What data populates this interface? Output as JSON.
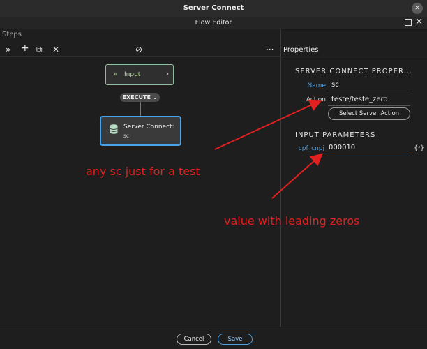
{
  "window": {
    "title": "Server Connect",
    "subtitle": "Flow Editor"
  },
  "left": {
    "label": "Steps",
    "toolbar": {
      "expand": "»",
      "add": "+",
      "copy": "⧉",
      "delete": "✕",
      "disable": "⊘",
      "more": "···"
    }
  },
  "flow": {
    "input_node": {
      "label": "Input",
      "icon": "»",
      "chevron": "›"
    },
    "execute_badge": "EXECUTE",
    "sc_node": {
      "label": "Server Connect:",
      "sub": "sc"
    }
  },
  "properties": {
    "title": "Properties",
    "section_main": "SERVER CONNECT PROPER...",
    "name_label": "Name",
    "name_value": "sc",
    "action_label": "Action",
    "action_value": "teste/teste_zero",
    "select_button": "Select Server Action",
    "section_params": "INPUT PARAMETERS",
    "param_label": "cpf_cnpj",
    "param_value": "000010",
    "fx": "{",
    "fx_end": "}"
  },
  "annotations": {
    "note1": "any sc just for a test",
    "note2": "value with leading zeros"
  },
  "footer": {
    "cancel": "Cancel",
    "save": "Save"
  },
  "colors": {
    "accent": "#4aa3e8",
    "annotation": "#e12020",
    "link_label": "#4aa3e8"
  }
}
